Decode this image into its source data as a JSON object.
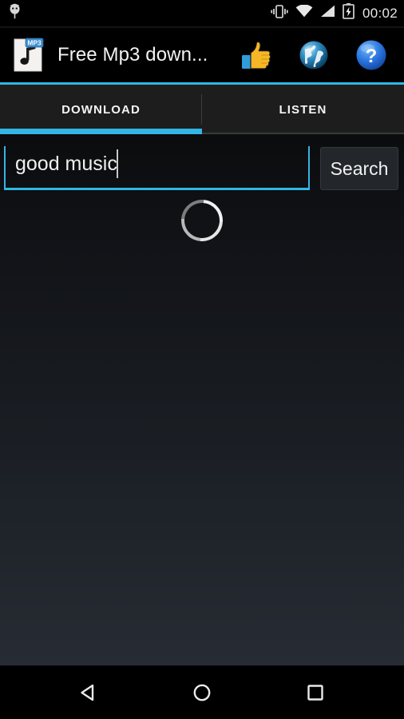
{
  "status_bar": {
    "notification_icon": "bug-notification-icon",
    "icons": [
      "vibrate-icon",
      "wifi-icon",
      "cellular-signal-icon",
      "battery-charging-icon"
    ],
    "time": "00:02"
  },
  "action_bar": {
    "app_icon": "mp3-file-icon",
    "app_icon_badge": "MP3",
    "title": "Free Mp3 down...",
    "actions": [
      {
        "name": "thumbs-up-icon",
        "label": "Rate"
      },
      {
        "name": "globe-icon",
        "label": "Web"
      },
      {
        "name": "help-question-icon",
        "label": "Help"
      }
    ]
  },
  "tabs": {
    "items": [
      {
        "label": "DOWNLOAD",
        "active": true
      },
      {
        "label": "LISTEN",
        "active": false
      }
    ],
    "accent_color": "#33b5e5"
  },
  "search": {
    "value": "good music",
    "placeholder": "",
    "button_label": "Search"
  },
  "loading": {
    "visible": true,
    "name": "loading-spinner"
  },
  "nav_bar": {
    "back": "back-icon",
    "home": "home-icon",
    "recents": "recents-icon"
  },
  "colors": {
    "accent": "#33b5e5",
    "background_top": "#0b0c0e",
    "background_bottom": "#272c34",
    "action_bar": "#000000",
    "tab_bar": "#1d1d1d"
  }
}
